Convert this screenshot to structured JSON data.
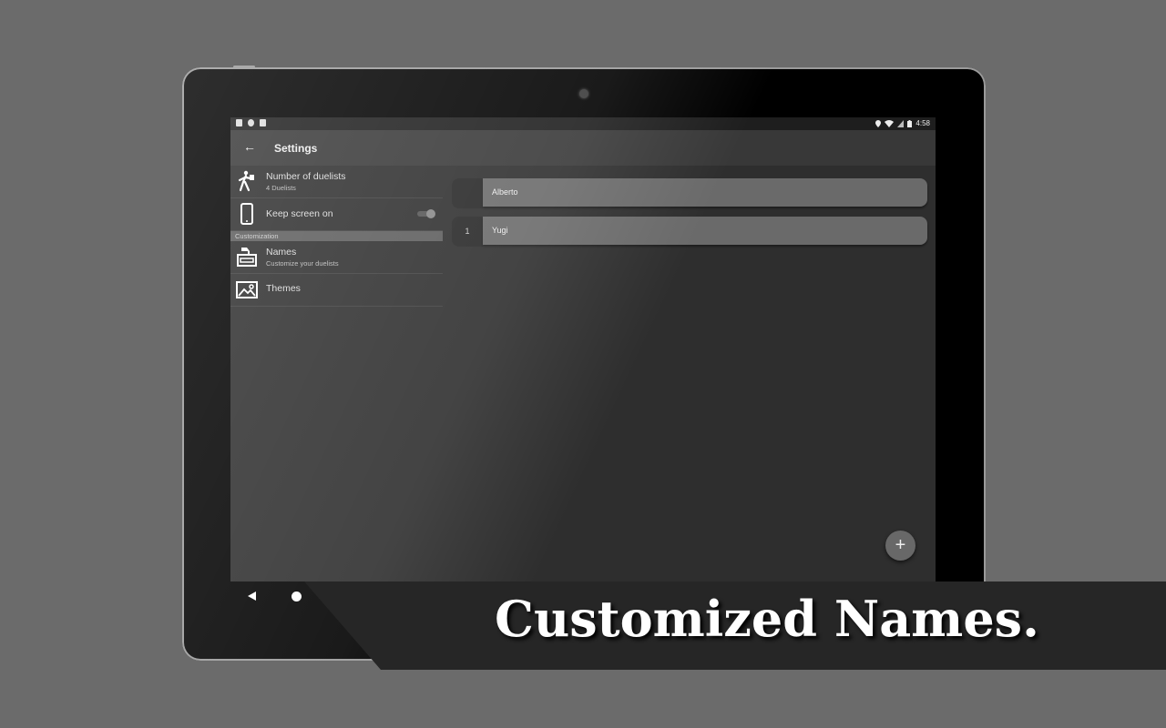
{
  "status_bar": {
    "left_icons": [
      "notification-icon",
      "sync-icon",
      "sd-card-icon"
    ],
    "right_icons": [
      "location-icon",
      "wifi-icon",
      "signal-icon",
      "battery-icon"
    ],
    "time": "4:58"
  },
  "app_bar": {
    "back_icon": "arrow-left-icon",
    "title": "Settings"
  },
  "settings": {
    "items": [
      {
        "icon": "walking-person-icon",
        "title": "Number of duelists",
        "subtitle": "4 Duelists"
      },
      {
        "icon": "smartphone-icon",
        "title": "Keep screen on",
        "toggle": true
      }
    ],
    "section_header": "Customization",
    "custom_items": [
      {
        "icon": "names-card-icon",
        "title": "Names",
        "subtitle": "Customize your duelists"
      },
      {
        "icon": "image-icon",
        "title": "Themes"
      }
    ]
  },
  "names": [
    {
      "index": "",
      "name": "Alberto"
    },
    {
      "index": "1",
      "name": "Yugi"
    }
  ],
  "fab": {
    "icon": "plus-icon",
    "label": "+"
  },
  "nav_bar": {
    "back": "back-triangle-icon",
    "home": "home-circle-icon"
  },
  "banner": {
    "text": "Customized Names."
  }
}
